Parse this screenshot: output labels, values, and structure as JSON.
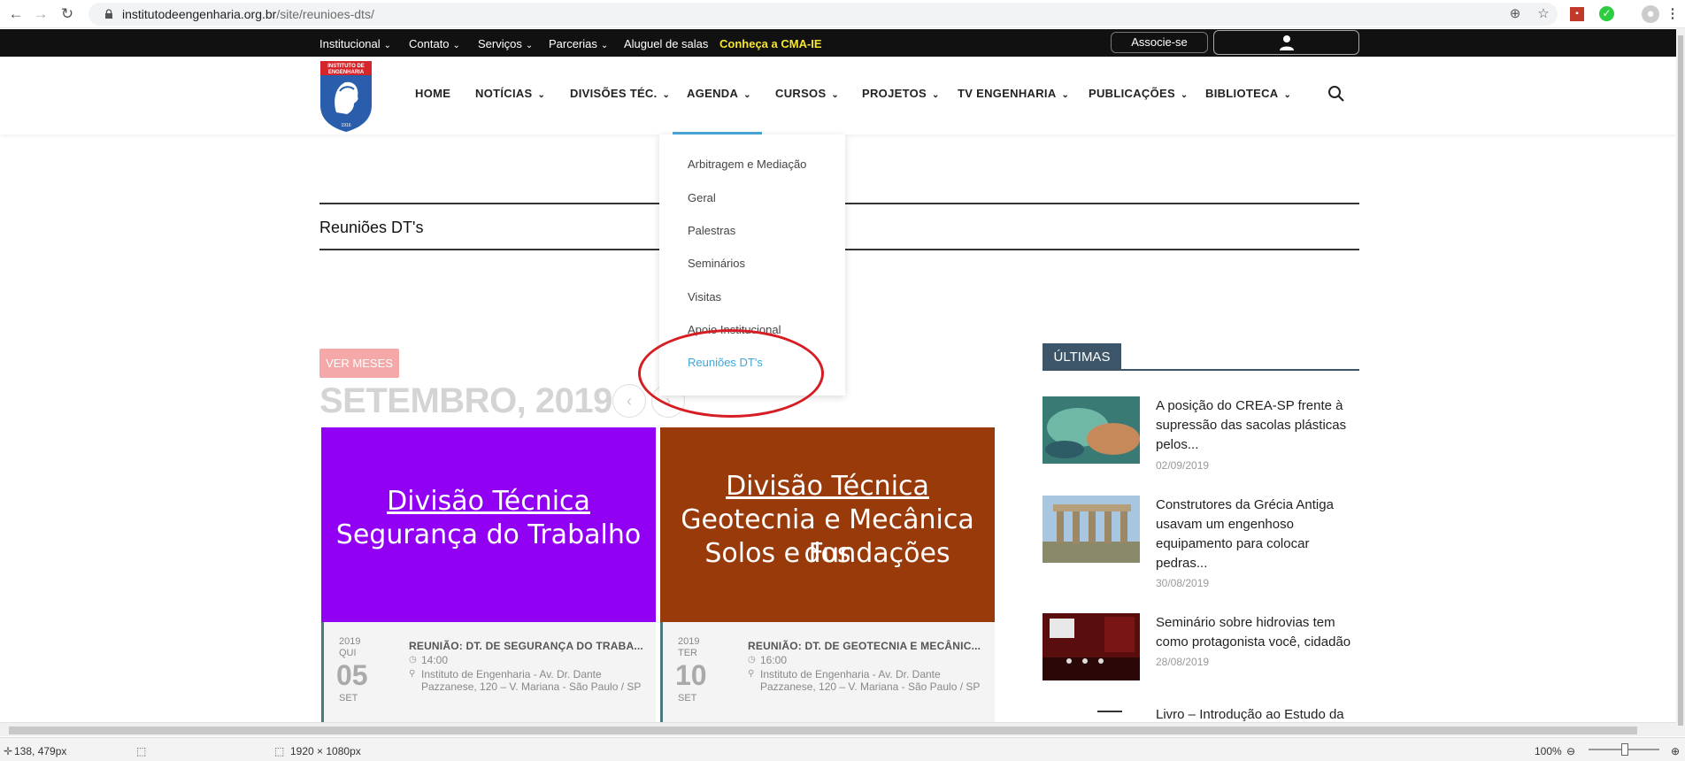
{
  "browser": {
    "url_domain": "institutodeengenharia.org.br",
    "url_path": "/site/reunioes-dts/"
  },
  "topbar": {
    "items": [
      "Institucional",
      "Contato",
      "Serviços",
      "Parcerias",
      "Aluguel de salas"
    ],
    "cma": "Conheça a CMA-IE",
    "associe": "Associe-se"
  },
  "logo": {
    "line1": "INSTITUTO DE",
    "line2": "ENGENHARIA",
    "year": "1916"
  },
  "nav": {
    "items": [
      "HOME",
      "NOTÍCIAS",
      "DIVISÕES TÉC.",
      "AGENDA",
      "CURSOS",
      "PROJETOS",
      "TV ENGENHARIA",
      "PUBLICAÇÕES",
      "BIBLIOTECA"
    ]
  },
  "page": {
    "title": "Reuniões DT's"
  },
  "dropdown": {
    "items": [
      "Arbitragem e Mediação",
      "Geral",
      "Palestras",
      "Seminários",
      "Visitas",
      "Apoio Institucional",
      "Reuniões DT's"
    ],
    "active_index": 6
  },
  "calendar": {
    "ver_meses": "VER MESES",
    "month_title": "SETEMBRO, 2019",
    "prev": "‹",
    "next": "›"
  },
  "events": [
    {
      "banner_line1": "Divisão Técnica",
      "banner_line2": "Segurança do Trabalho",
      "banner_line3": "",
      "color": "#9100f3",
      "year": "2019",
      "dow": "QUI",
      "day": "05",
      "month": "SET",
      "title": "REUNIÃO: DT. DE SEGURANÇA DO TRABA...",
      "time": "14:00",
      "place": "Instituto de Engenharia - Av. Dr. Dante Pazzanese, 120 – V. Mariana - São Paulo / SP"
    },
    {
      "banner_line1": "Divisão Técnica",
      "banner_line2": "Geotecnia e Mecânica dos",
      "banner_line3": "Solos e Fundações",
      "color": "#993a0a",
      "year": "2019",
      "dow": "TER",
      "day": "10",
      "month": "SET",
      "title": "REUNIÃO: DT. DE GEOTECNIA E MECÂNIC...",
      "time": "16:00",
      "place": "Instituto de Engenharia - Av. Dr. Dante Pazzanese, 120 – V. Mariana - São Paulo / SP"
    }
  ],
  "sidebar": {
    "heading": "ÚLTIMAS",
    "posts": [
      {
        "title": "A posição do CREA-SP frente à supressão das sacolas plásticas pelos...",
        "date": "02/09/2019"
      },
      {
        "title": "Construtores da Grécia Antiga usavam um engenhoso equipamento para colocar pedras...",
        "date": "30/08/2019"
      },
      {
        "title": "Seminário sobre hidrovias tem como protagonista você, cidadão",
        "date": "28/08/2019"
      },
      {
        "title": "Livro – Introdução ao Estudo da",
        "date": ""
      }
    ]
  },
  "statusbar": {
    "cursor": "138, 479px",
    "size": "1920 × 1080px",
    "zoom": "100%"
  }
}
